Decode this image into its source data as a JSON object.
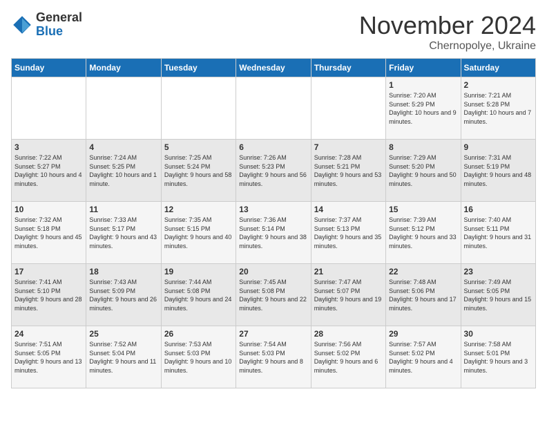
{
  "logo": {
    "general": "General",
    "blue": "Blue"
  },
  "header": {
    "month_title": "November 2024",
    "subtitle": "Chernopolye, Ukraine"
  },
  "days_of_week": [
    "Sunday",
    "Monday",
    "Tuesday",
    "Wednesday",
    "Thursday",
    "Friday",
    "Saturday"
  ],
  "weeks": [
    [
      {
        "day": "",
        "info": ""
      },
      {
        "day": "",
        "info": ""
      },
      {
        "day": "",
        "info": ""
      },
      {
        "day": "",
        "info": ""
      },
      {
        "day": "",
        "info": ""
      },
      {
        "day": "1",
        "info": "Sunrise: 7:20 AM\nSunset: 5:29 PM\nDaylight: 10 hours and 9 minutes."
      },
      {
        "day": "2",
        "info": "Sunrise: 7:21 AM\nSunset: 5:28 PM\nDaylight: 10 hours and 7 minutes."
      }
    ],
    [
      {
        "day": "3",
        "info": "Sunrise: 7:22 AM\nSunset: 5:27 PM\nDaylight: 10 hours and 4 minutes."
      },
      {
        "day": "4",
        "info": "Sunrise: 7:24 AM\nSunset: 5:25 PM\nDaylight: 10 hours and 1 minute."
      },
      {
        "day": "5",
        "info": "Sunrise: 7:25 AM\nSunset: 5:24 PM\nDaylight: 9 hours and 58 minutes."
      },
      {
        "day": "6",
        "info": "Sunrise: 7:26 AM\nSunset: 5:23 PM\nDaylight: 9 hours and 56 minutes."
      },
      {
        "day": "7",
        "info": "Sunrise: 7:28 AM\nSunset: 5:21 PM\nDaylight: 9 hours and 53 minutes."
      },
      {
        "day": "8",
        "info": "Sunrise: 7:29 AM\nSunset: 5:20 PM\nDaylight: 9 hours and 50 minutes."
      },
      {
        "day": "9",
        "info": "Sunrise: 7:31 AM\nSunset: 5:19 PM\nDaylight: 9 hours and 48 minutes."
      }
    ],
    [
      {
        "day": "10",
        "info": "Sunrise: 7:32 AM\nSunset: 5:18 PM\nDaylight: 9 hours and 45 minutes."
      },
      {
        "day": "11",
        "info": "Sunrise: 7:33 AM\nSunset: 5:17 PM\nDaylight: 9 hours and 43 minutes."
      },
      {
        "day": "12",
        "info": "Sunrise: 7:35 AM\nSunset: 5:15 PM\nDaylight: 9 hours and 40 minutes."
      },
      {
        "day": "13",
        "info": "Sunrise: 7:36 AM\nSunset: 5:14 PM\nDaylight: 9 hours and 38 minutes."
      },
      {
        "day": "14",
        "info": "Sunrise: 7:37 AM\nSunset: 5:13 PM\nDaylight: 9 hours and 35 minutes."
      },
      {
        "day": "15",
        "info": "Sunrise: 7:39 AM\nSunset: 5:12 PM\nDaylight: 9 hours and 33 minutes."
      },
      {
        "day": "16",
        "info": "Sunrise: 7:40 AM\nSunset: 5:11 PM\nDaylight: 9 hours and 31 minutes."
      }
    ],
    [
      {
        "day": "17",
        "info": "Sunrise: 7:41 AM\nSunset: 5:10 PM\nDaylight: 9 hours and 28 minutes."
      },
      {
        "day": "18",
        "info": "Sunrise: 7:43 AM\nSunset: 5:09 PM\nDaylight: 9 hours and 26 minutes."
      },
      {
        "day": "19",
        "info": "Sunrise: 7:44 AM\nSunset: 5:08 PM\nDaylight: 9 hours and 24 minutes."
      },
      {
        "day": "20",
        "info": "Sunrise: 7:45 AM\nSunset: 5:08 PM\nDaylight: 9 hours and 22 minutes."
      },
      {
        "day": "21",
        "info": "Sunrise: 7:47 AM\nSunset: 5:07 PM\nDaylight: 9 hours and 19 minutes."
      },
      {
        "day": "22",
        "info": "Sunrise: 7:48 AM\nSunset: 5:06 PM\nDaylight: 9 hours and 17 minutes."
      },
      {
        "day": "23",
        "info": "Sunrise: 7:49 AM\nSunset: 5:05 PM\nDaylight: 9 hours and 15 minutes."
      }
    ],
    [
      {
        "day": "24",
        "info": "Sunrise: 7:51 AM\nSunset: 5:05 PM\nDaylight: 9 hours and 13 minutes."
      },
      {
        "day": "25",
        "info": "Sunrise: 7:52 AM\nSunset: 5:04 PM\nDaylight: 9 hours and 11 minutes."
      },
      {
        "day": "26",
        "info": "Sunrise: 7:53 AM\nSunset: 5:03 PM\nDaylight: 9 hours and 10 minutes."
      },
      {
        "day": "27",
        "info": "Sunrise: 7:54 AM\nSunset: 5:03 PM\nDaylight: 9 hours and 8 minutes."
      },
      {
        "day": "28",
        "info": "Sunrise: 7:56 AM\nSunset: 5:02 PM\nDaylight: 9 hours and 6 minutes."
      },
      {
        "day": "29",
        "info": "Sunrise: 7:57 AM\nSunset: 5:02 PM\nDaylight: 9 hours and 4 minutes."
      },
      {
        "day": "30",
        "info": "Sunrise: 7:58 AM\nSunset: 5:01 PM\nDaylight: 9 hours and 3 minutes."
      }
    ]
  ]
}
